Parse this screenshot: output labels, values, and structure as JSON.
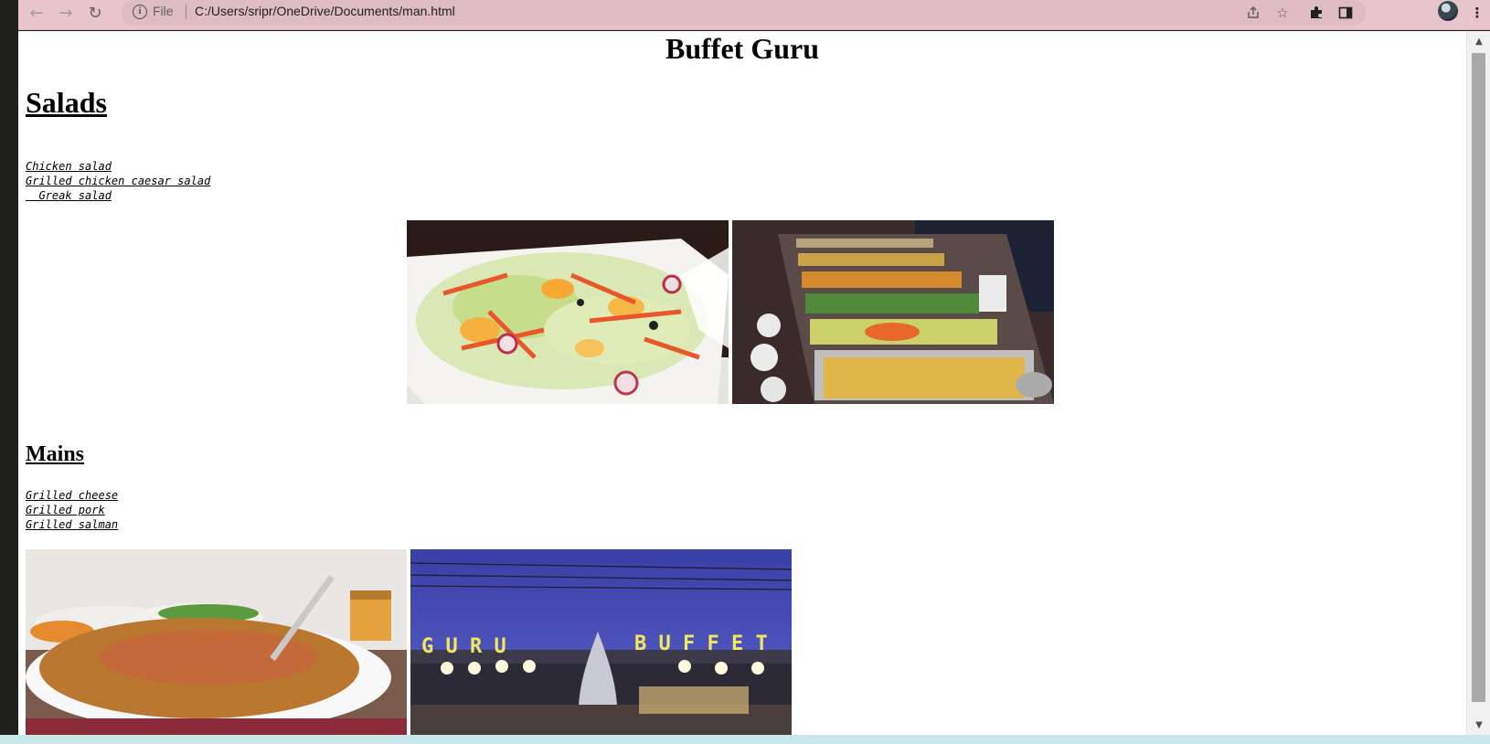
{
  "browser": {
    "scheme_label": "File",
    "url": "C:/Users/sripr/OneDrive/Documents/man.html",
    "icons": {
      "back": "arrow-left-icon",
      "forward": "arrow-right-icon",
      "reload": "reload-icon",
      "site_info": "info-icon",
      "share": "share-icon",
      "bookmark": "star-icon",
      "extensions": "puzzle-icon",
      "side_panel": "side-panel-icon",
      "menu": "kebab-menu-icon"
    }
  },
  "page": {
    "title": "Buffet Guru",
    "sections": {
      "salads": {
        "heading": "Salads",
        "items": [
          "Chicken salad",
          "Grilled chicken caesar salad",
          "  Greak salad"
        ],
        "images": [
          "salad-bowl-photo",
          "buffet-line-photo"
        ]
      },
      "mains": {
        "heading": "Mains",
        "items": [
          "Grilled cheese",
          "Grilled pork",
          "Grilled salman"
        ],
        "images": [
          "omelette-plate-photo",
          "guru-buffet-storefront-photo"
        ],
        "storefront_sign": "GURU BUFFET"
      }
    }
  },
  "colors": {
    "toolbar": "#e8c5cd",
    "omnibox": "#dfbcc4",
    "page_background": "#ffffff",
    "taskbar": "#c9e7e9"
  }
}
